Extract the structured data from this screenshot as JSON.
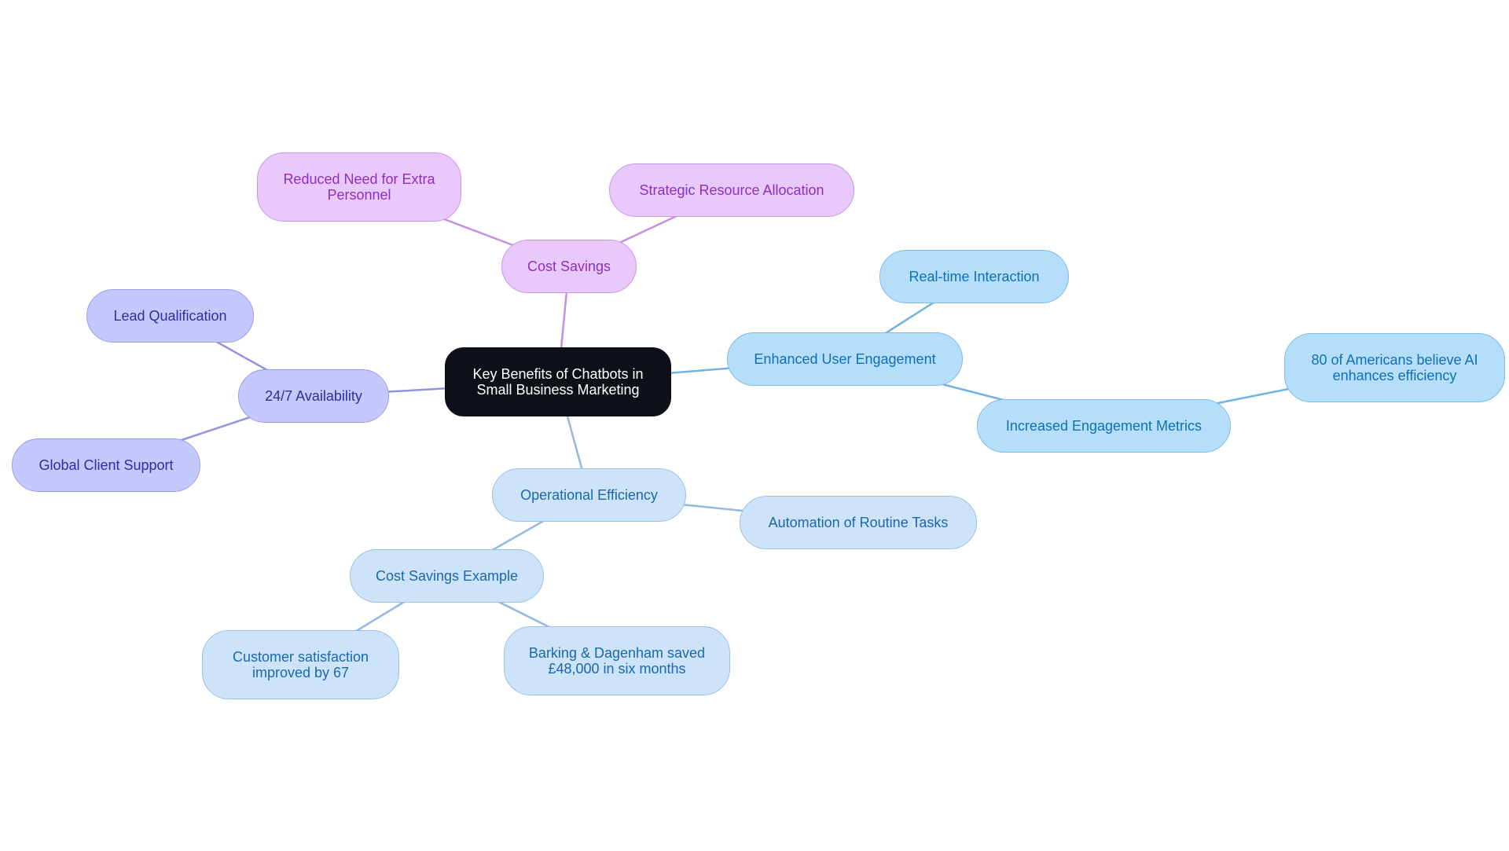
{
  "diagram": {
    "type": "mind-map",
    "root": {
      "id": "root",
      "label": "Key Benefits of Chatbots in\nSmall Business Marketing"
    },
    "colors": {
      "root": "#0d1117",
      "purple_branch": "#e9c8fb",
      "indigo_branch": "#c5c8fc",
      "sky_branch": "#b4defa",
      "pale_branch": "#cde3fa",
      "purple_edge": "#c58ee6",
      "indigo_edge": "#8f93e0",
      "sky_edge": "#6fb3e3",
      "pale_edge": "#93b9e0"
    },
    "nodes": [
      {
        "id": "root",
        "label": "Key Benefits of Chatbots in\nSmall Business Marketing",
        "style": "root"
      },
      {
        "id": "cost-savings",
        "label": "Cost Savings",
        "style": "purple",
        "parent": "root"
      },
      {
        "id": "reduced-need",
        "label": "Reduced Need for Extra\nPersonnel",
        "style": "purple",
        "parent": "cost-savings"
      },
      {
        "id": "strategic-allocation",
        "label": "Strategic Resource Allocation",
        "style": "purple",
        "parent": "cost-savings"
      },
      {
        "id": "availability",
        "label": "24/7 Availability",
        "style": "indigo",
        "parent": "root"
      },
      {
        "id": "lead-qualification",
        "label": "Lead Qualification",
        "style": "indigo",
        "parent": "availability"
      },
      {
        "id": "global-support",
        "label": "Global Client Support",
        "style": "indigo",
        "parent": "availability"
      },
      {
        "id": "user-engagement",
        "label": "Enhanced User Engagement",
        "style": "sky",
        "parent": "root"
      },
      {
        "id": "realtime-interaction",
        "label": "Real-time Interaction",
        "style": "sky",
        "parent": "user-engagement"
      },
      {
        "id": "engagement-metrics",
        "label": "Increased Engagement Metrics",
        "style": "sky",
        "parent": "user-engagement"
      },
      {
        "id": "americans-ai",
        "label": "80 of Americans believe AI\nenhances efficiency",
        "style": "sky",
        "parent": "engagement-metrics"
      },
      {
        "id": "operational-efficiency",
        "label": "Operational Efficiency",
        "style": "pale",
        "parent": "root"
      },
      {
        "id": "automation-tasks",
        "label": "Automation of Routine Tasks",
        "style": "pale",
        "parent": "operational-efficiency"
      },
      {
        "id": "cost-savings-example",
        "label": "Cost Savings Example",
        "style": "pale",
        "parent": "operational-efficiency"
      },
      {
        "id": "customer-satisfaction",
        "label": "Customer satisfaction\nimproved by 67",
        "style": "pale",
        "parent": "cost-savings-example"
      },
      {
        "id": "barking-dagenham",
        "label": "Barking & Dagenham saved\n£48,000 in six months",
        "style": "pale",
        "parent": "cost-savings-example"
      }
    ]
  }
}
